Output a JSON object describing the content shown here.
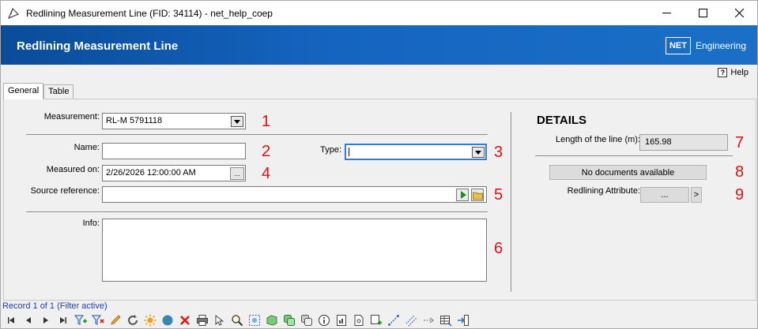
{
  "window": {
    "title": "Redlining Measurement Line (FID: 34114) - net_help_coep",
    "minimize_label": "—",
    "maximize_label": "☐",
    "close_label": "✕"
  },
  "header": {
    "title": "Redlining Measurement Line",
    "brand_box": "NET",
    "brand_text": "Engineering"
  },
  "help": {
    "icon_text": "?",
    "label": "Help"
  },
  "tabs": [
    {
      "label": "General",
      "active": true
    },
    {
      "label": "Table",
      "active": false
    }
  ],
  "form": {
    "measurement": {
      "label": "Measurement:",
      "value": "RL-M 5791118"
    },
    "name": {
      "label": "Name:",
      "value": ""
    },
    "type": {
      "label": "Type:",
      "value": ""
    },
    "measured_on": {
      "label": "Measured on:",
      "value": "2/26/2026 12:00:00 AM",
      "button": "..."
    },
    "source_reference": {
      "label": "Source reference:",
      "value": ""
    },
    "info": {
      "label": "Info:",
      "value": ""
    }
  },
  "details": {
    "heading": "DETAILS",
    "length_label": "Length of the line (m):",
    "length_value": "165.98",
    "documents_button": "No documents available",
    "redlining_label": "Redlining Attribute:",
    "redlining_button": "...",
    "redlining_next": ">"
  },
  "markers": [
    "1",
    "2",
    "3",
    "4",
    "5",
    "6",
    "7",
    "8",
    "9"
  ],
  "status": {
    "record_text": "Record 1 of 1 (Filter active)"
  },
  "toolbar_icons": [
    "first-record-icon",
    "previous-record-icon",
    "next-record-icon",
    "last-record-icon",
    "add-filter-icon",
    "remove-filter-icon",
    "edit-icon",
    "refresh-icon",
    "highlight-icon",
    "globe-icon",
    "delete-icon",
    "print-icon",
    "select-icon",
    "zoom-icon",
    "zoom-extent-icon",
    "layer-icon",
    "copy-icon",
    "paste-icon",
    "info-icon",
    "report-icon",
    "document-icon",
    "add-document-icon",
    "measure-icon",
    "measure-alt-icon",
    "connect-icon",
    "table-icon",
    "export-icon"
  ],
  "colors": {
    "header_blue": "#1565c0",
    "marker_red": "#e01010",
    "record_blue": "#1f3fb4"
  }
}
